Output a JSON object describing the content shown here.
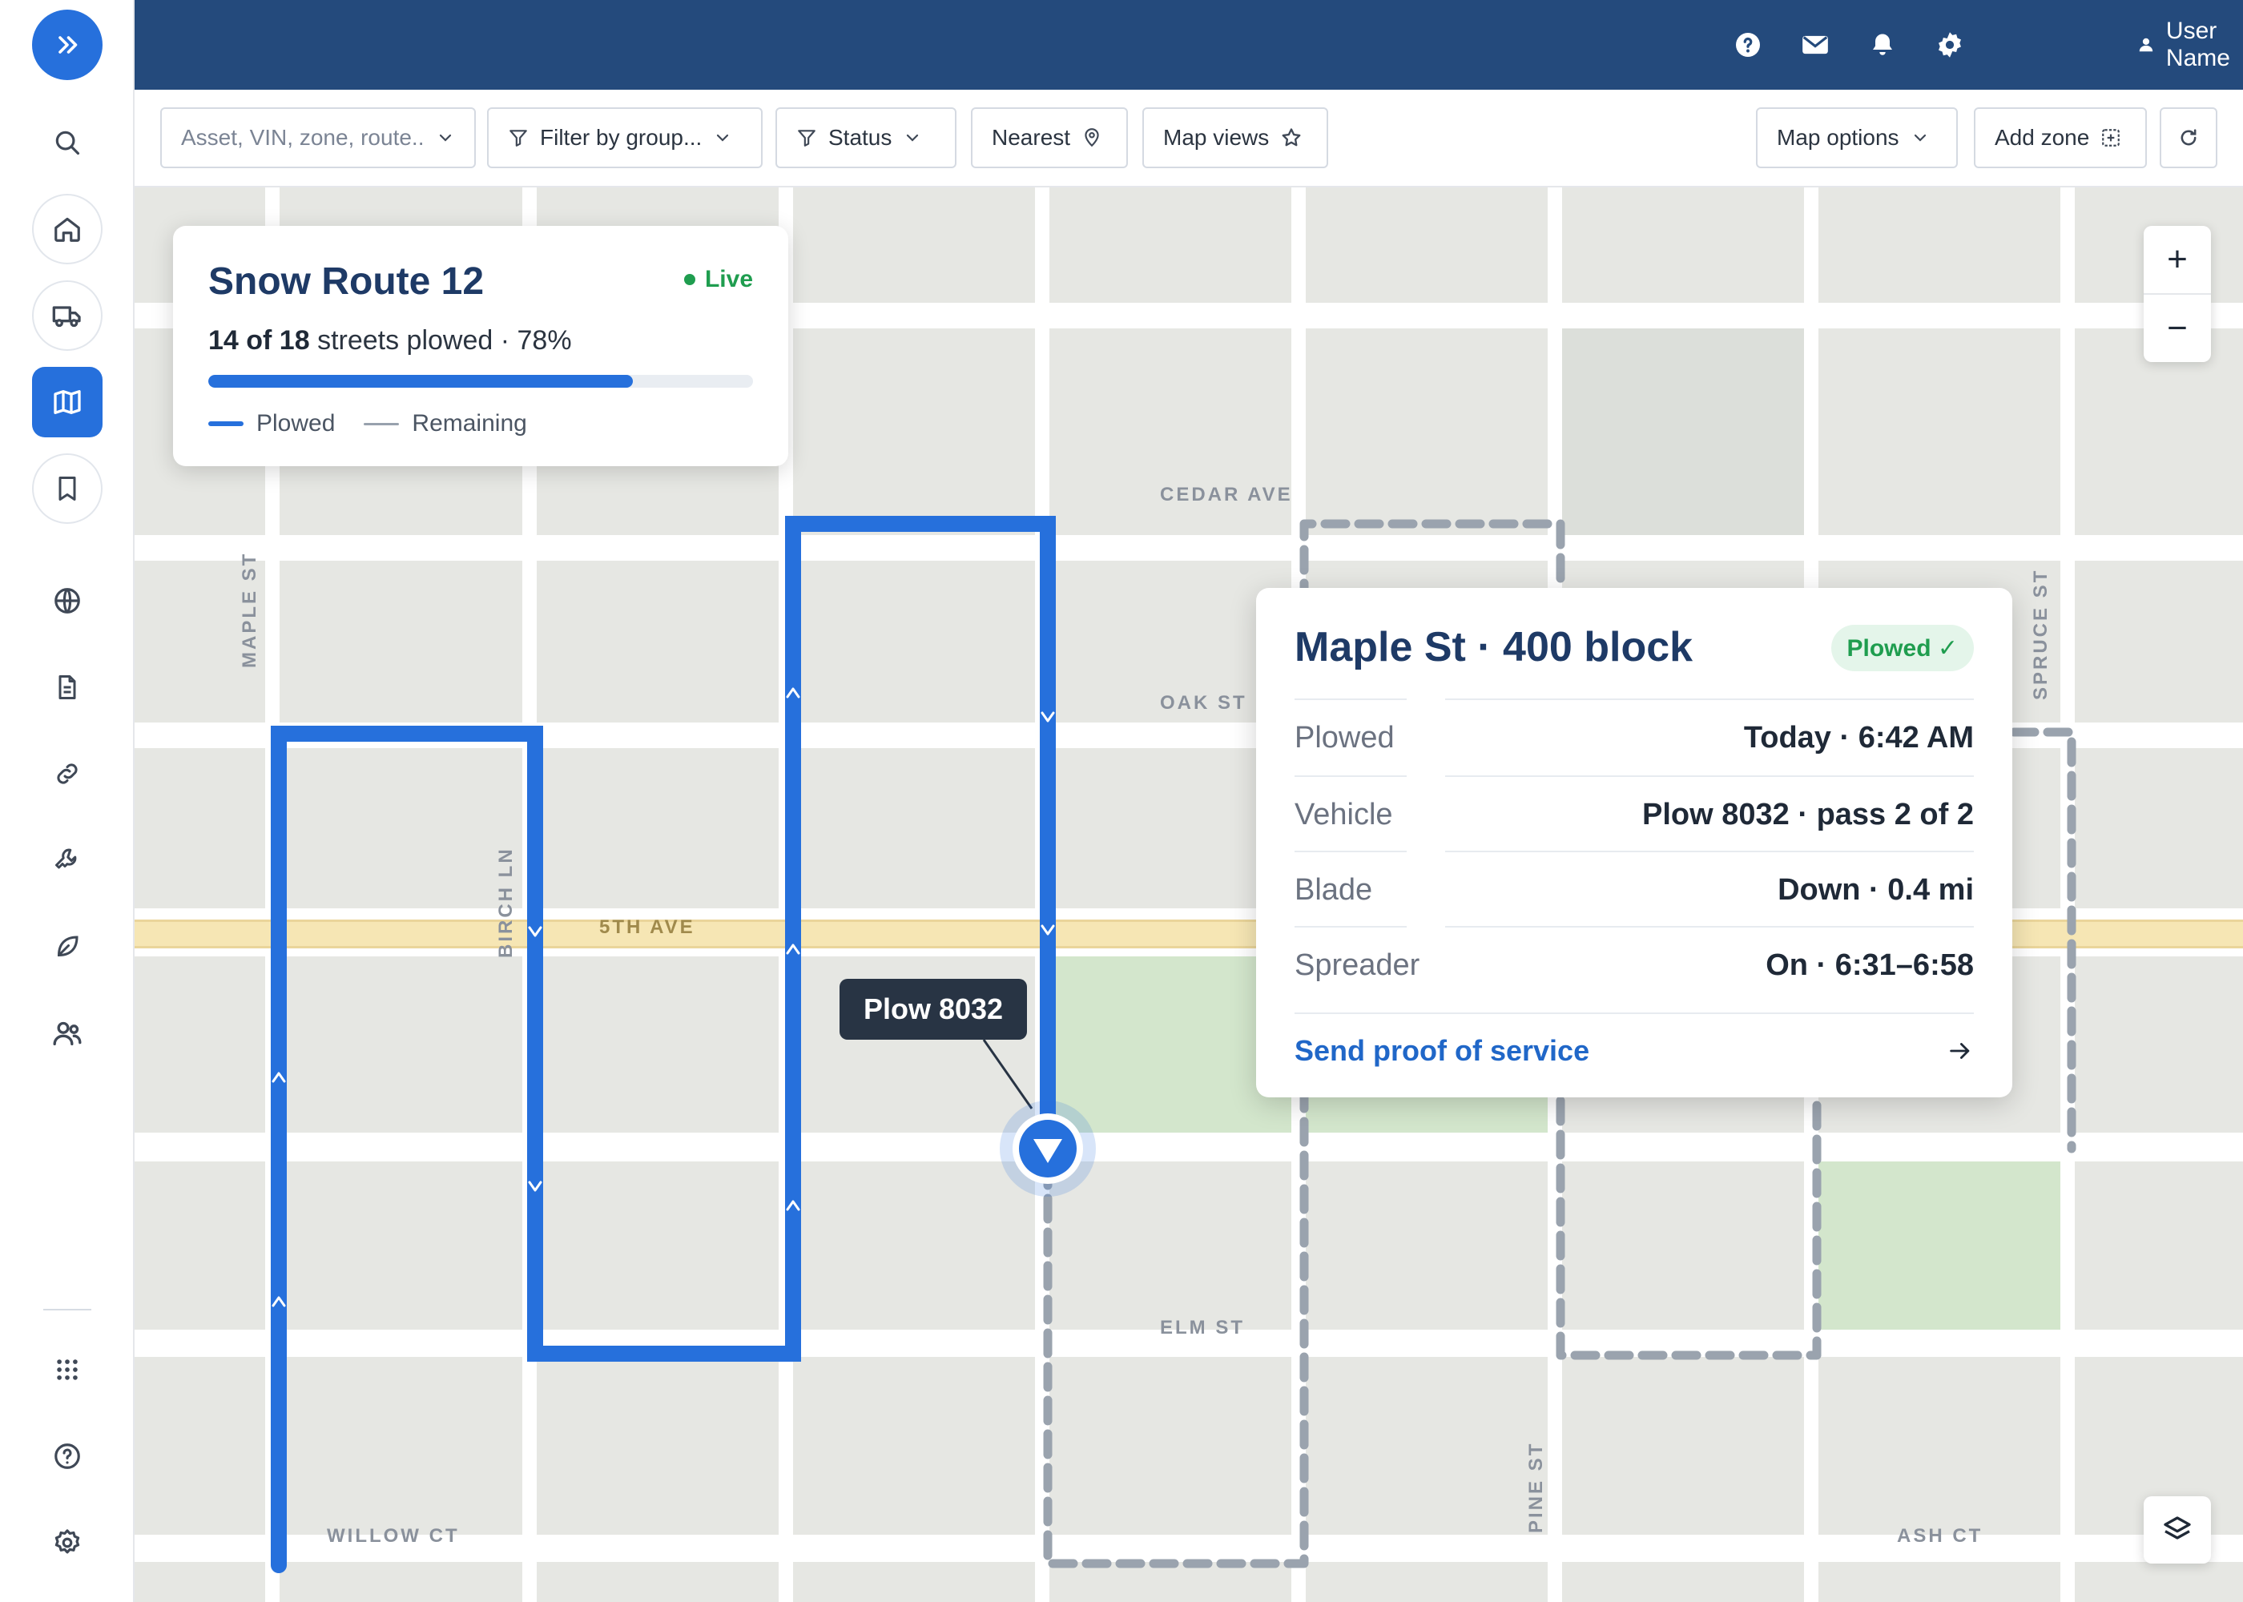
{
  "header": {
    "user_name": "User Name",
    "icons": [
      "help-icon",
      "mail-icon",
      "bell-icon",
      "gear-icon",
      "user-icon"
    ]
  },
  "sidebar": {
    "items": [
      "search",
      "home",
      "vehicles",
      "map",
      "bookmark",
      "globe",
      "document",
      "link",
      "wrench",
      "leaf",
      "users",
      "apps",
      "help",
      "settings"
    ],
    "active": "map"
  },
  "filters": {
    "search_placeholder": "Asset, VIN, zone, route...",
    "group": "Filter by group...",
    "status": "Status",
    "nearest": "Nearest",
    "map_views": "Map views",
    "map_options": "Map options",
    "add_zone": "Add zone"
  },
  "map": {
    "streets": {
      "cedar": "CEDAR AVE",
      "oak": "OAK ST",
      "fifth": "5TH AVE",
      "elm": "ELM ST",
      "willow": "WILLOW CT",
      "ash": "ASH CT",
      "maple": "MAPLE ST",
      "birch": "BIRCH LN",
      "pine": "PINE ST",
      "spruce": "SPRUCE ST"
    },
    "vehicle_label": "Plow 8032",
    "colors": {
      "plowed": "#2670dc",
      "remaining": "#9aa3ae",
      "park": "#d3e6cc",
      "block": "#e6e7e3",
      "major_road": "#f6e6b4"
    }
  },
  "route_card": {
    "title": "Snow Route 12",
    "live": "Live",
    "plowed_count": "14 of 18",
    "progress_suffix": "streets plowed · 78%",
    "progress_fraction": 0.78,
    "legend_plowed": "Plowed",
    "legend_remaining": "Remaining"
  },
  "detail": {
    "title": "Maple St · 400 block",
    "badge": "Plowed ✓",
    "rows": [
      {
        "label": "Plowed",
        "value": "Today · 6:42 AM"
      },
      {
        "label": "Vehicle",
        "value": "Plow 8032 · pass 2 of 2"
      },
      {
        "label": "Blade",
        "value": "Down · 0.4 mi"
      },
      {
        "label": "Spreader",
        "value": "On · 6:31–6:58"
      }
    ],
    "action": "Send proof of service"
  },
  "zoom": {
    "in": "+",
    "out": "−"
  }
}
